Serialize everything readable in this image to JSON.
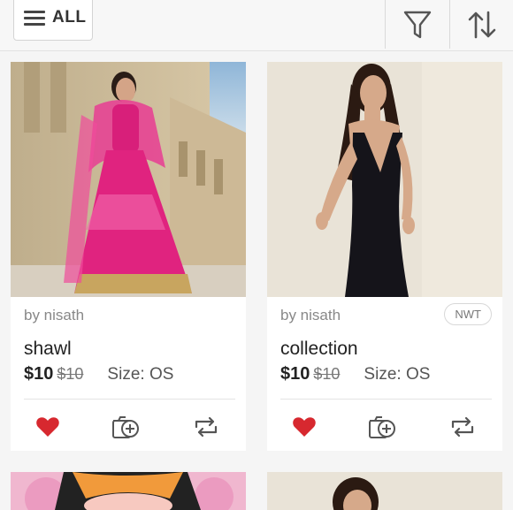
{
  "header": {
    "all_label": "ALL",
    "icons": [
      "menu-icon",
      "filter-icon",
      "sort-icon"
    ]
  },
  "listings": [
    {
      "seller": "by nisath",
      "title": "shawl",
      "price": "$10",
      "original_price": "$10",
      "size": "Size: OS",
      "badge": "",
      "liked": true
    },
    {
      "seller": "by nisath",
      "title": "collection",
      "price": "$10",
      "original_price": "$10",
      "size": "Size: OS",
      "badge": "NWT",
      "liked": true
    }
  ],
  "colors": {
    "like": "#d7282f",
    "icon": "#555555",
    "background": "#f5f5f5"
  }
}
